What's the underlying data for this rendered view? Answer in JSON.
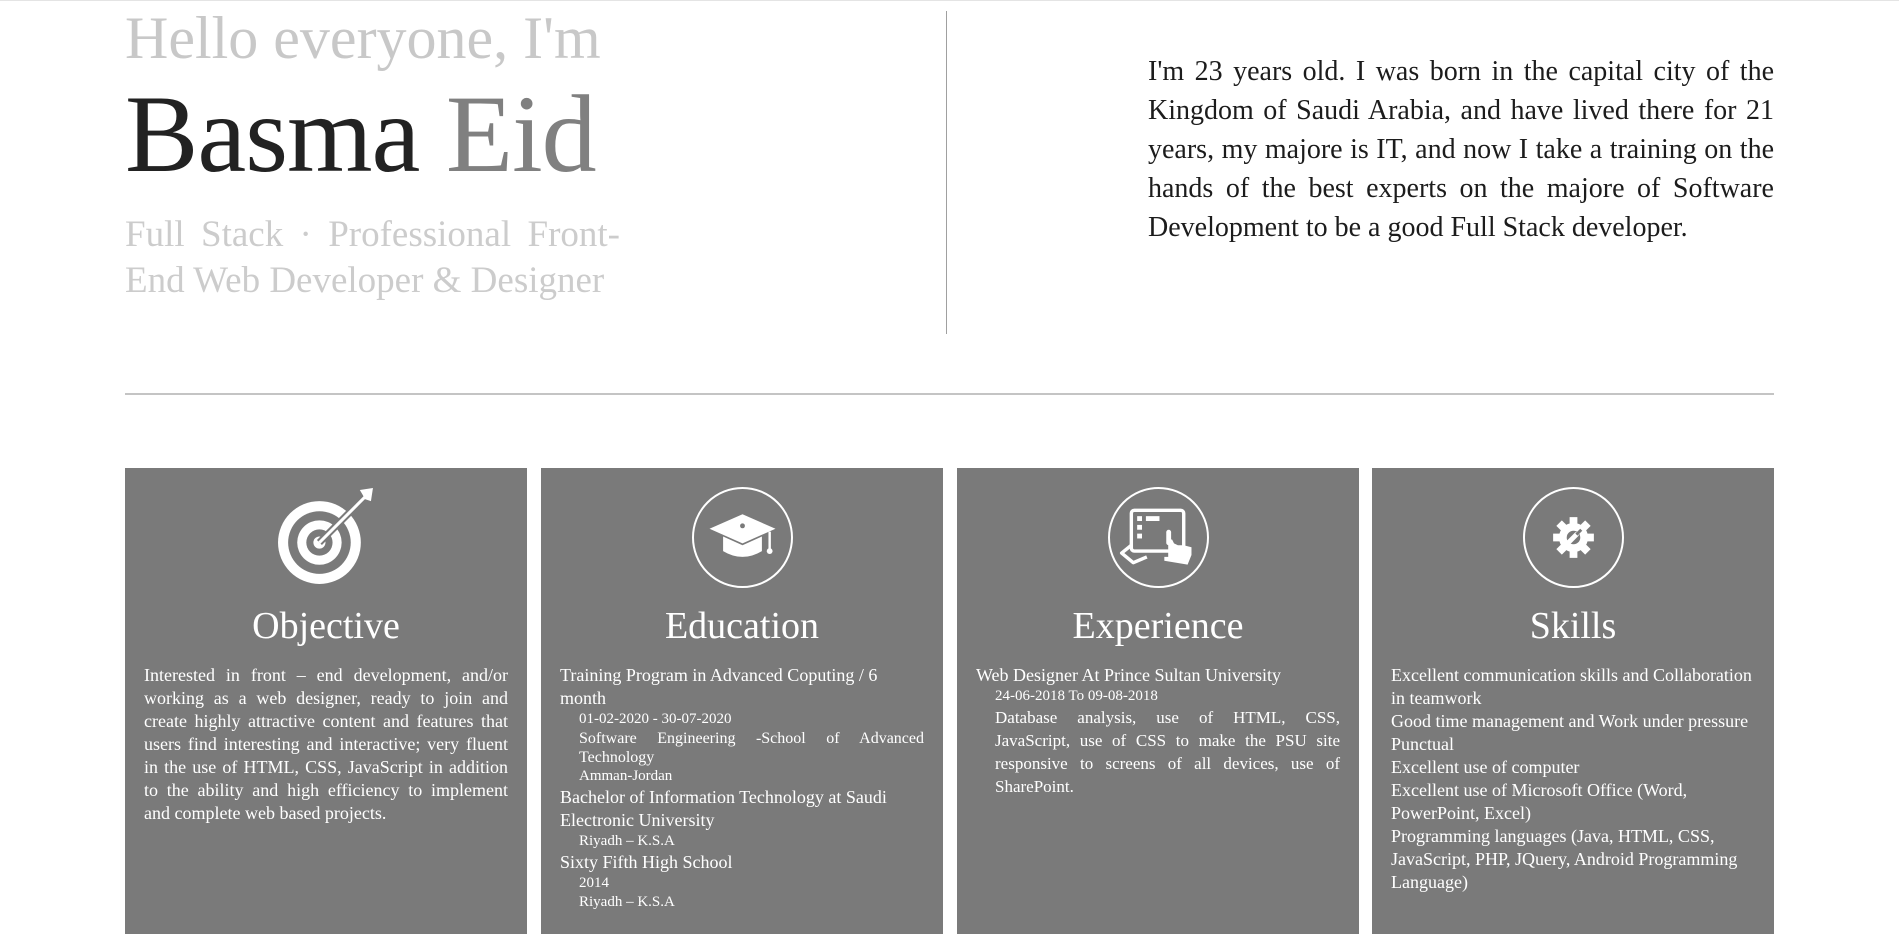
{
  "hero": {
    "greeting": "Hello everyone, I'm",
    "first_name": "Basma",
    "last_name": "Eid",
    "role": "Full Stack · Professional Front-End Web Developer & Designer"
  },
  "about": {
    "text": "I'm 23 years old. I was born in the capital city of the Kingdom of Saudi Arabia, and have lived there for 21 years, my majore is IT, and now I take a training on the hands of the best experts on the majore of Software Development to be a good Full Stack developer."
  },
  "cards": {
    "objective": {
      "icon": "target-icon",
      "title": "Objective",
      "text": "Interested in front – end development, and/or working as a web designer, ready to join and create highly attractive content and features that users find interesting and interactive; very fluent in the use of HTML, CSS, JavaScript in addition to the ability and high efficiency to implement and complete web based projects."
    },
    "education": {
      "icon": "graduation-cap-icon",
      "title": "Education",
      "entries": [
        {
          "title": "Training Program in Advanced Coputing / 6 month",
          "lines": [
            "01-02-2020 - 30-07-2020",
            "Software Engineering -School of Advanced Technology",
            "Amman-Jordan"
          ]
        },
        {
          "title": "Bachelor of Information Technology at Saudi Electronic University",
          "lines": [
            "Riyadh – K.S.A"
          ]
        },
        {
          "title": "Sixty Fifth High School",
          "lines": [
            "2014",
            "Riyadh – K.S.A"
          ]
        }
      ]
    },
    "experience": {
      "icon": "touch-tablet-icon",
      "title": "Experience",
      "job": "Web Designer At Prince Sultan University",
      "dates": "24-06-2018 To 09-08-2018",
      "description": "Database analysis, use of HTML, CSS, JavaScript, use of CSS to make the PSU site responsive to screens of all devices, use of SharePoint."
    },
    "skills": {
      "icon": "gear-wrench-icon",
      "title": "Skills",
      "items": [
        "Excellent communication skills and Collaboration in teamwork",
        "Good time management and Work under pressure",
        "Punctual",
        "Excellent use of computer",
        "Excellent use of Microsoft Office (Word, PowerPoint, Excel)",
        "Programming languages (Java, HTML, CSS, JavaScript, PHP, JQuery, Android Programming Language)"
      ]
    }
  },
  "colors": {
    "card_bg": "#7a7a7a",
    "greeting": "#c8c8c8",
    "name_first": "#222222",
    "name_last": "#808080",
    "role": "#cccccc"
  }
}
